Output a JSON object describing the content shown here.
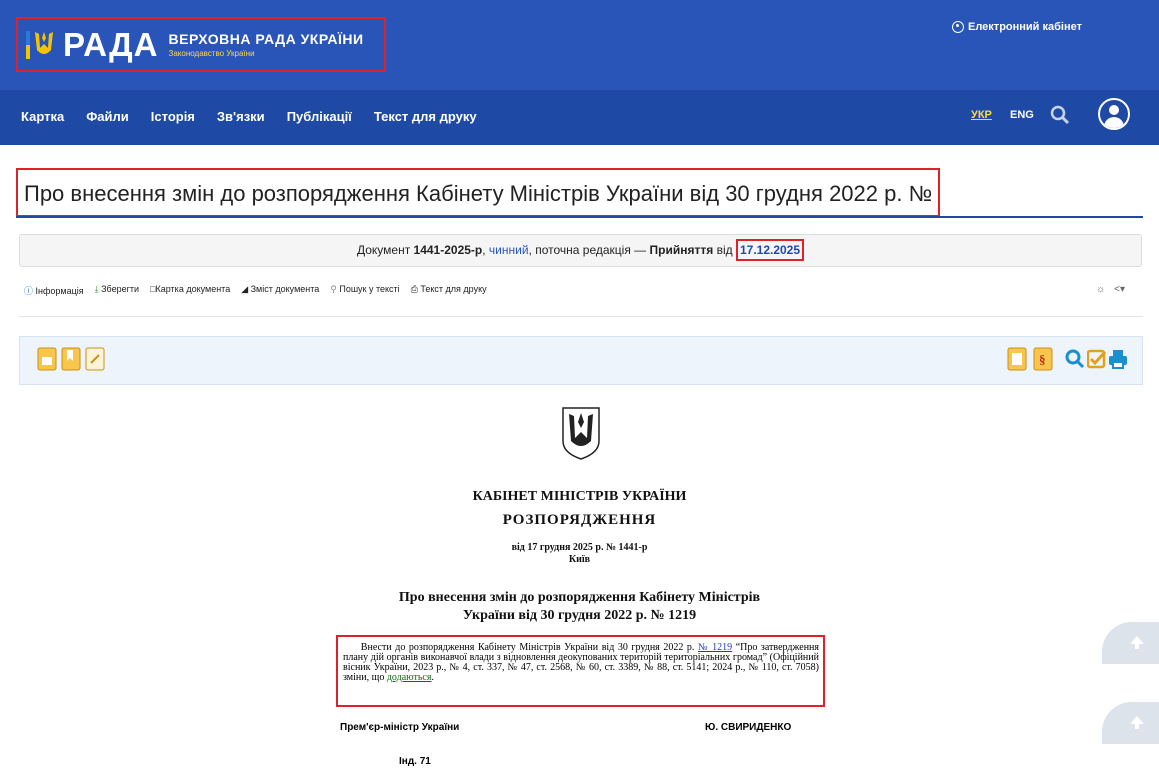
{
  "header": {
    "brand_word": "РАДА",
    "brand_title": "ВЕРХОВНА РАДА УКРАЇНИ",
    "brand_subtitle": "Законодавство України",
    "cabinet_label": "Електронний кабінет"
  },
  "nav": {
    "items": [
      "Картка",
      "Файли",
      "Історія",
      "Зв'язки",
      "Публікації",
      "Текст для друку"
    ],
    "lang_ukr": "УКР",
    "lang_eng": "ENG"
  },
  "page": {
    "title": "Про внесення змін до розпорядження Кабінету Міністрів України від 30 грудня 2022 р. № 1219"
  },
  "status": {
    "prefix": "Документ",
    "doc_number": "1441-2025-р",
    "state": "чинний",
    "edition": ", поточна редакція —",
    "adoption_label": "Прийняття",
    "from": "від",
    "date": "17.12.2025"
  },
  "toolbar": {
    "info": "Інформація",
    "save": "Зберегти",
    "card": "Картка документа",
    "contents": "Зміст документа",
    "search": "Пошук у тексті",
    "print": "Текст для друку"
  },
  "document": {
    "org": "КАБІНЕТ МІНІСТРІВ УКРАЇНИ",
    "type": "РОЗПОРЯДЖЕННЯ",
    "date_line": "від 17 грудня 2025 р. № 1441-р",
    "city": "Київ",
    "heading_1": "Про внесення змін до розпорядження Кабінету Міністрів",
    "heading_2": "України від 30 грудня 2022 р. № 1219",
    "para_before_link": "Внести до розпорядження Кабінету Міністрів України від 30 грудня 2022 р. ",
    "para_link": "№ 1219",
    "para_after_link": " “Про затвердження плану дій органів виконавчої влади з відновлення деокупованих територій територіальних громад” (Офіційний вісник України, 2023 р., № 4, ст. 337, № 47, ст. 2568, № 60, ст. 3389, № 88, ст. 5141; 2024 р., № 110, ст. 7058) зміни, що ",
    "para_attached": "додаються",
    "para_end": ".",
    "signer_title": "Прем'єр-міністр України",
    "signer_name": "Ю. СВИРИДЕНКО",
    "index": "Інд. 71"
  },
  "colors": {
    "header_bg": "#2a55b8",
    "nav_bg": "#1e4aa6",
    "highlight_border": "#e0212b",
    "accent_yellow": "#ffd84a"
  }
}
